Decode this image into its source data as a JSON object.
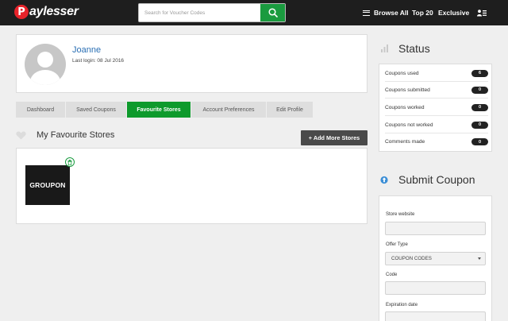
{
  "header": {
    "logo_letter": "P",
    "logo_text": "aylesser",
    "search_placeholder": "Search for Voucher Codes",
    "nav": {
      "browse_all": "Browse All",
      "top_20": "Top 20",
      "exclusive": "Exclusive"
    }
  },
  "profile": {
    "name": "Joanne",
    "last_login": "Last login: 08 Jul 2016"
  },
  "tabs": [
    {
      "label": "Dashboard",
      "active": false
    },
    {
      "label": "Saved Coupons",
      "active": false
    },
    {
      "label": "Favourite Stores",
      "active": true
    },
    {
      "label": "Account Preferences",
      "active": false
    },
    {
      "label": "Edit Profile",
      "active": false
    }
  ],
  "favourites": {
    "title": "My Favourite Stores",
    "add_button": "+ Add More Stores",
    "stores": [
      {
        "name": "GROUPON"
      }
    ]
  },
  "status": {
    "title": "Status",
    "rows": [
      {
        "label": "Coupons used",
        "count": "6"
      },
      {
        "label": "Coupons submitted",
        "count": "0"
      },
      {
        "label": "Coupons worked",
        "count": "0"
      },
      {
        "label": "Coupons not worked",
        "count": "0"
      },
      {
        "label": "Comments made",
        "count": "0"
      }
    ]
  },
  "submit": {
    "title": "Submit Coupon",
    "store_website_label": "Store website",
    "offer_type_label": "Offer Type",
    "offer_type_value": "COUPON CODES",
    "code_label": "Code",
    "expiration_label": "Expiration date"
  },
  "colors": {
    "topbar": "#1e1e1e",
    "brand_red": "#e8232a",
    "accent_green": "#0e9a2c",
    "link_blue": "#2a6fb4"
  }
}
